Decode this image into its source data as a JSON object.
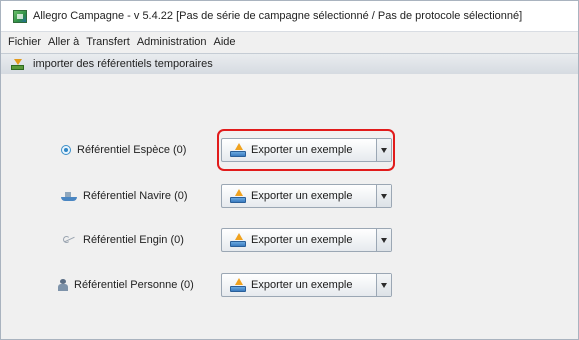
{
  "window": {
    "title": "Allegro Campagne - v 5.4.22 [Pas de série de campagne sélectionné / Pas de protocole sélectionné]"
  },
  "menu": {
    "items": [
      {
        "label": "Fichier",
        "name": "menu-fichier"
      },
      {
        "label": "Aller à",
        "name": "menu-aller-a"
      },
      {
        "label": "Transfert",
        "name": "menu-transfert"
      },
      {
        "label": "Administration",
        "name": "menu-administration"
      },
      {
        "label": "Aide",
        "name": "menu-aide"
      }
    ]
  },
  "panel": {
    "title": "importer des référentiels temporaires",
    "icon": "import-icon"
  },
  "rows": [
    {
      "label": "Référentiel Espèce (0)",
      "icon": "radio-icon",
      "button": "Exporter un exemple"
    },
    {
      "label": "Référentiel Navire (0)",
      "icon": "ship-icon",
      "button": "Exporter un exemple"
    },
    {
      "label": "Référentiel Engin (0)",
      "icon": "hook-icon",
      "button": "Exporter un exemple"
    },
    {
      "label": "Référentiel Personne (0)",
      "icon": "person-icon",
      "button": "Exporter un exemple"
    }
  ],
  "colors": {
    "highlight": "#e11b1b",
    "accent": "#3a7bc0"
  }
}
